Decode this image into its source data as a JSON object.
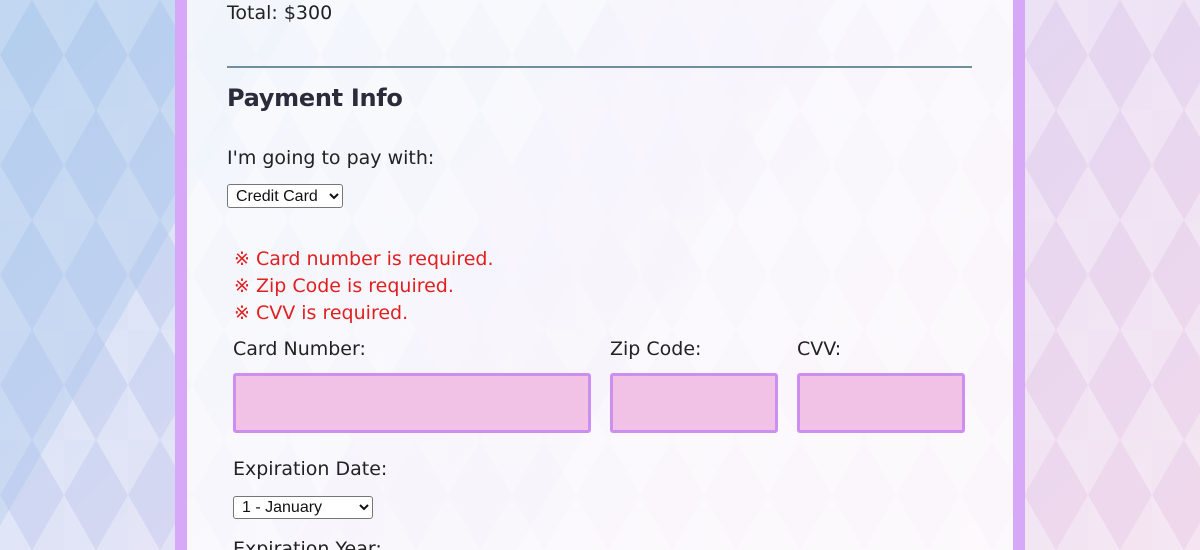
{
  "order": {
    "total": "Total: $300"
  },
  "payment": {
    "section_title": "Payment Info",
    "pay_with_label": "I'm going to pay with:",
    "method_selected": "Credit Card",
    "errors": [
      "※ Card number is required.",
      "※ Zip Code is required.",
      "※ CVV is required."
    ],
    "card_number_label": "Card Number:",
    "zip_label": "Zip Code:",
    "cvv_label": "CVV:",
    "card_number_value": "",
    "zip_value": "",
    "cvv_value": "",
    "exp_date_label": "Expiration Date:",
    "exp_month_selected": "1 - January",
    "exp_year_label": "Expiration Year:"
  },
  "colors": {
    "accent_border": "#d6a8f7",
    "input_bg": "#f2c2e6",
    "input_border": "#cc8ff0",
    "error": "#e02020",
    "divider": "#6f8fa0"
  }
}
